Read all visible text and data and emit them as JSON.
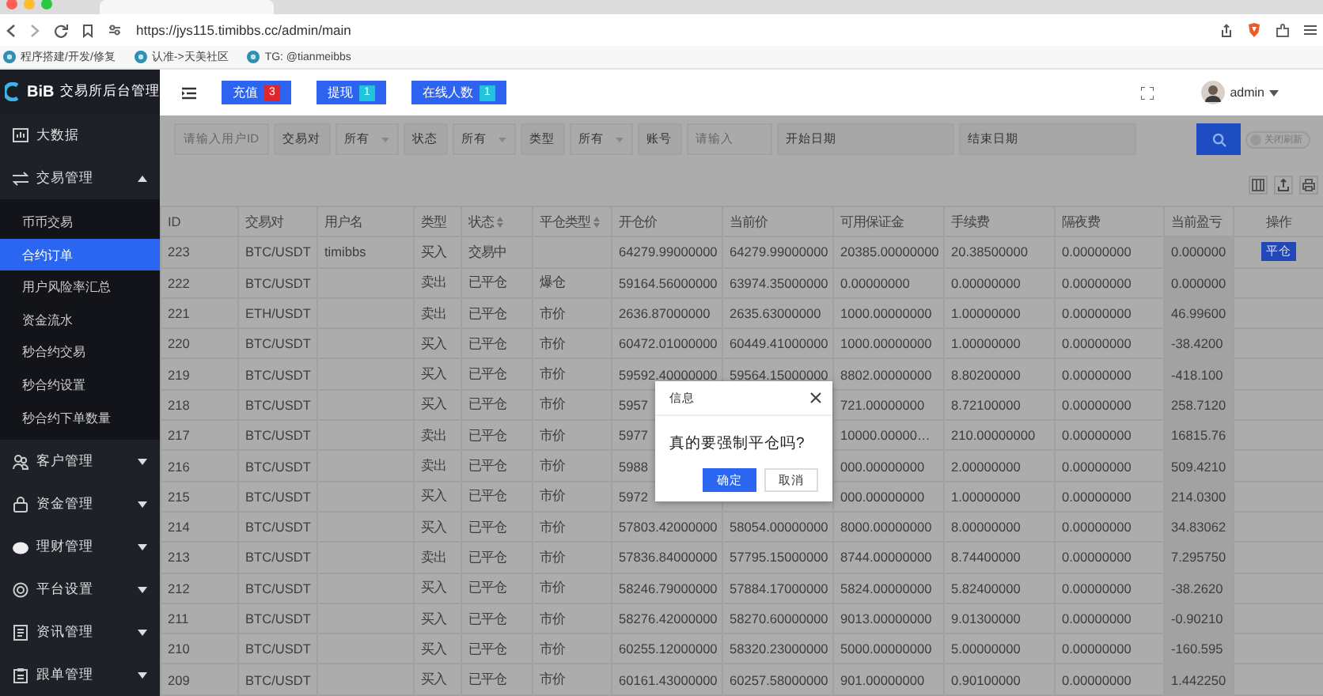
{
  "browser": {
    "url": "https://jys115.timibbs.cc/admin/main",
    "bookmarks": [
      "程序搭建/开发/修复",
      "认准->天美社区",
      "TG: @tianmeibbs"
    ]
  },
  "header": {
    "logo": "BiB",
    "title": "交易所后台管理",
    "buttons": [
      {
        "label": "充值",
        "count": "3",
        "color": "#e0262a"
      },
      {
        "label": "提现",
        "count": "1",
        "color": "#22c4dc"
      },
      {
        "label": "在线人数",
        "count": "1",
        "color": "#22c4dc"
      }
    ],
    "user": "admin"
  },
  "sidebar": {
    "items": [
      {
        "label": "大数据",
        "selected": false
      },
      {
        "label": "交易管理",
        "selected": false,
        "expanded": true,
        "children": [
          {
            "label": "币币交易",
            "selected": false
          },
          {
            "label": "合约订单",
            "selected": true
          },
          {
            "label": "用户风险率汇总",
            "selected": false
          },
          {
            "label": "资金流水",
            "selected": false
          },
          {
            "label": "秒合约交易",
            "selected": false
          },
          {
            "label": "秒合约设置",
            "selected": false
          },
          {
            "label": "秒合约下单数量",
            "selected": false
          }
        ]
      },
      {
        "label": "客户管理",
        "selected": false,
        "expanded": false
      },
      {
        "label": "资金管理",
        "selected": false,
        "expanded": false
      },
      {
        "label": "理财管理",
        "selected": false,
        "expanded": false
      },
      {
        "label": "平台设置",
        "selected": false,
        "expanded": false
      },
      {
        "label": "资讯管理",
        "selected": false,
        "expanded": false
      },
      {
        "label": "跟单管理",
        "selected": false,
        "expanded": false
      }
    ]
  },
  "filters": [
    {
      "kind": "input",
      "placeholder": "请输入用户ID"
    },
    {
      "kind": "select",
      "label": "交易对",
      "value": "所有"
    },
    {
      "kind": "select",
      "label": "状态",
      "value": "所有"
    },
    {
      "kind": "select",
      "label": "类型",
      "value": "所有"
    },
    {
      "kind": "input",
      "label": "账号",
      "placeholder": "请输入"
    },
    {
      "kind": "date",
      "label": "开始日期"
    },
    {
      "kind": "date",
      "label": "结束日期"
    }
  ],
  "refresh_toggle": {
    "label": "关闭刷新",
    "on": false
  },
  "table": {
    "columns": [
      {
        "label": "ID",
        "sortable": false
      },
      {
        "label": "交易对",
        "sortable": false
      },
      {
        "label": "用户名",
        "sortable": false
      },
      {
        "label": "类型",
        "sortable": false
      },
      {
        "label": "状态",
        "sortable": true
      },
      {
        "label": "平仓类型",
        "sortable": true
      },
      {
        "label": "开仓价",
        "sortable": false
      },
      {
        "label": "当前价",
        "sortable": false
      },
      {
        "label": "可用保证金",
        "sortable": false
      },
      {
        "label": "手续费",
        "sortable": false
      },
      {
        "label": "隔夜费",
        "sortable": false
      },
      {
        "label": "当前盈亏",
        "sortable": false
      },
      {
        "label": "操作",
        "sortable": false
      }
    ],
    "rows": [
      {
        "cells": [
          "223",
          "BTC/USDT",
          "timibbs",
          "买入",
          "交易中",
          null,
          "64279.99000000",
          "64279.99000000",
          "20385.00000000",
          "20.38500000",
          "0.00000000",
          "0.000000"
        ],
        "action": "平仓"
      },
      {
        "cells": [
          "222",
          "BTC/USDT",
          null,
          "卖出",
          "已平仓",
          "爆仓",
          "59164.56000000",
          "63974.35000000",
          "0.00000000",
          "0.00000000",
          "0.00000000",
          "0.000000"
        ]
      },
      {
        "cells": [
          "221",
          "ETH/USDT",
          null,
          "卖出",
          "已平仓",
          "市价",
          "2636.87000000",
          "2635.63000000",
          "1000.00000000",
          "1.00000000",
          "0.00000000",
          "46.99600"
        ]
      },
      {
        "cells": [
          "220",
          "BTC/USDT",
          null,
          "买入",
          "已平仓",
          "市价",
          "60472.01000000",
          "60449.41000000",
          "1000.00000000",
          "1.00000000",
          "0.00000000",
          "-38.4200"
        ]
      },
      {
        "cells": [
          "219",
          "BTC/USDT",
          null,
          "买入",
          "已平仓",
          "市价",
          "59592.40000000",
          "59564.15000000",
          "8802.00000000",
          "8.80200000",
          "0.00000000",
          "-418.100"
        ]
      },
      {
        "cells": [
          "218",
          "BTC/USDT",
          null,
          "买入",
          "已平仓",
          "市价",
          "5957",
          null,
          "721.00000000",
          "8.72100000",
          "0.00000000",
          "258.7120"
        ]
      },
      {
        "cells": [
          "217",
          "BTC/USDT",
          null,
          "卖出",
          "已平仓",
          "市价",
          "5977",
          null,
          "10000.00000…",
          "210.00000000",
          "0.00000000",
          "16815.76"
        ]
      },
      {
        "cells": [
          "216",
          "BTC/USDT",
          null,
          "卖出",
          "已平仓",
          "市价",
          "5988",
          null,
          "000.00000000",
          "2.00000000",
          "0.00000000",
          "509.4210"
        ]
      },
      {
        "cells": [
          "215",
          "BTC/USDT",
          null,
          "买入",
          "已平仓",
          "市价",
          "5972",
          null,
          "000.00000000",
          "1.00000000",
          "0.00000000",
          "214.0300"
        ]
      },
      {
        "cells": [
          "214",
          "BTC/USDT",
          null,
          "买入",
          "已平仓",
          "市价",
          "57803.42000000",
          "58054.00000000",
          "8000.00000000",
          "8.00000000",
          "0.00000000",
          "34.83062"
        ]
      },
      {
        "cells": [
          "213",
          "BTC/USDT",
          null,
          "卖出",
          "已平仓",
          "市价",
          "57836.84000000",
          "57795.15000000",
          "8744.00000000",
          "8.74400000",
          "0.00000000",
          "7.295750"
        ]
      },
      {
        "cells": [
          "212",
          "BTC/USDT",
          null,
          "买入",
          "已平仓",
          "市价",
          "58246.79000000",
          "57884.17000000",
          "5824.00000000",
          "5.82400000",
          "0.00000000",
          "-38.2620"
        ]
      },
      {
        "cells": [
          "211",
          "BTC/USDT",
          null,
          "买入",
          "已平仓",
          "市价",
          "58276.42000000",
          "58270.60000000",
          "9013.00000000",
          "9.01300000",
          "0.00000000",
          "-0.90210"
        ]
      },
      {
        "cells": [
          "210",
          "BTC/USDT",
          null,
          "买入",
          "已平仓",
          "市价",
          "60255.12000000",
          "58320.23000000",
          "5000.00000000",
          "5.00000000",
          "0.00000000",
          "-160.595"
        ]
      },
      {
        "cells": [
          "209",
          "BTC/USDT",
          null,
          "买入",
          "已平仓",
          "市价",
          "60161.43000000",
          "60257.58000000",
          "901.00000000",
          "0.90100000",
          "0.00000000",
          "1.442250"
        ]
      }
    ]
  },
  "dialog": {
    "title": "信息",
    "message": "真的要强制平仓吗?",
    "buttons": [
      {
        "label": "确定",
        "primary": true
      },
      {
        "label": "取消",
        "primary": false
      }
    ]
  }
}
